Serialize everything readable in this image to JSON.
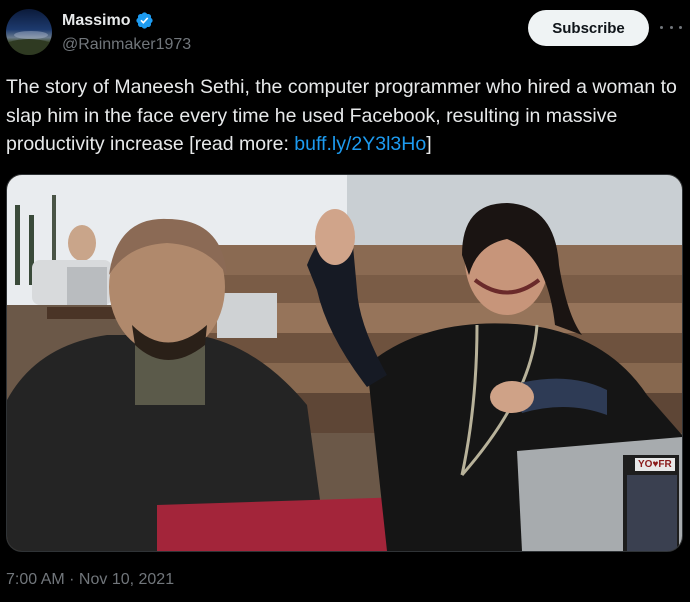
{
  "author": {
    "display_name": "Massimo",
    "handle": "@Rainmaker1973",
    "verified": true,
    "avatar_icon": "landscape-avatar"
  },
  "actions": {
    "subscribe_label": "Subscribe",
    "more_icon": "more-horizontal-icon"
  },
  "tweet": {
    "text_before_link": "The story of Maneesh Sethi, the computer programmer who hired a woman to slap him in the face every time he used Facebook, resulting in massive productivity increase [read more: ",
    "link_text": "buff.ly/2Y3l3Ho",
    "text_after_link": "]"
  },
  "media": {
    "type": "photo",
    "laptop_sticker_text": "YO♥FR"
  },
  "meta": {
    "timestamp": "7:00 AM · Nov 10, 2021"
  },
  "colors": {
    "background": "#000000",
    "text": "#e7e9ea",
    "muted": "#71767b",
    "link": "#1d9bf0",
    "verified": "#1d9bf0",
    "button_bg": "#eff3f4"
  }
}
